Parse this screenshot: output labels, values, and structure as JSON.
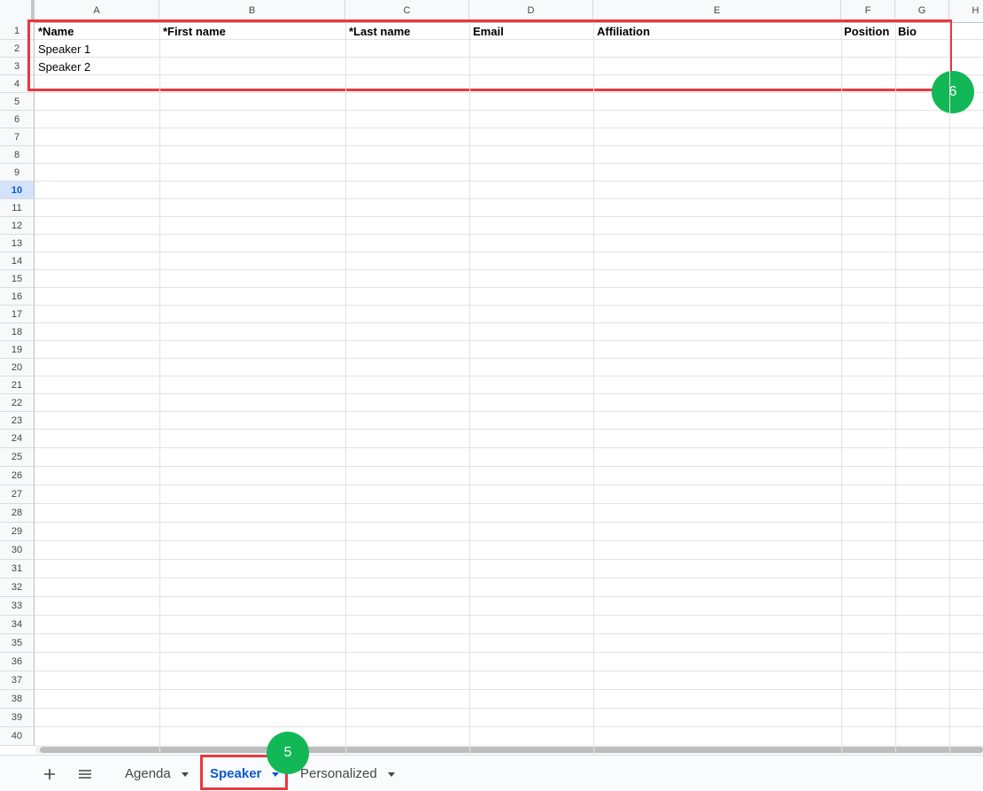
{
  "columns": [
    "A",
    "B",
    "C",
    "D",
    "E",
    "F",
    "G",
    "H"
  ],
  "row_numbers": [
    "1",
    "2",
    "3",
    "4",
    "5",
    "6",
    "7",
    "8",
    "9",
    "10",
    "11",
    "12",
    "13",
    "14",
    "15",
    "16",
    "17",
    "18",
    "19",
    "20",
    "21",
    "22",
    "23",
    "24",
    "25",
    "26",
    "27",
    "28",
    "29",
    "30",
    "31",
    "32",
    "33",
    "34",
    "35",
    "36",
    "37",
    "38",
    "39",
    "40"
  ],
  "selected_row": "10",
  "header_row": {
    "name": "*Name",
    "first_name": "*First name",
    "last_name": "*Last name",
    "email": "Email",
    "affiliation": "Affiliation",
    "position": "Position",
    "bio": "Bio"
  },
  "rows": [
    {
      "name": "Speaker 1"
    },
    {
      "name": "Speaker 2"
    }
  ],
  "annotations": {
    "badge_table": "6",
    "badge_tab": "5"
  },
  "tabs": [
    {
      "label": "Agenda",
      "active": false
    },
    {
      "label": "Speaker",
      "active": true
    },
    {
      "label": "Personalized",
      "active": false
    }
  ],
  "toolbar": {
    "add_sheet_icon": "plus-icon",
    "all_sheets_icon": "menu-icon"
  },
  "colors": {
    "highlight": "#e8383d",
    "badge": "#12b856",
    "active_tab": "#0b57d0"
  }
}
